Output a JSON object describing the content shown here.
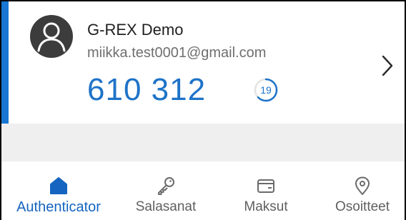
{
  "account": {
    "issuer": "G-REX Demo",
    "name": "miikka.test0001@gmail.com",
    "code": "610 312",
    "timer_seconds": "19",
    "timer_remaining_fraction": 0.63
  },
  "nav": {
    "items": [
      {
        "label": "Authenticator",
        "icon": "home-icon",
        "active": true
      },
      {
        "label": "Salasanat",
        "icon": "key-icon",
        "active": false
      },
      {
        "label": "Maksut",
        "icon": "card-icon",
        "active": false
      },
      {
        "label": "Osoitteet",
        "icon": "location-pin-icon",
        "active": false
      }
    ]
  },
  "colors": {
    "accent": "#1976d2",
    "code": "#1e73c8",
    "active_nav": "#1565c0",
    "inactive_nav": "#5f5f5f",
    "band": "#efefef"
  }
}
